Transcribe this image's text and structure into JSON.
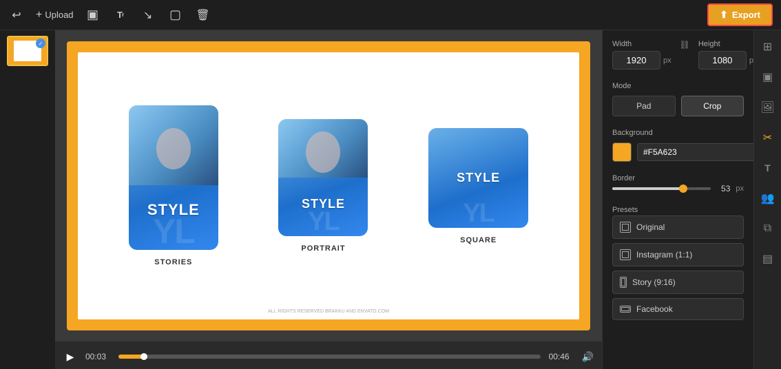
{
  "toolbar": {
    "upload_label": "Upload",
    "export_label": "Export"
  },
  "canvas": {
    "copyright": "ALL RIGHTS RESERVED BRAKKU AND ENVATO.COM",
    "cards": [
      {
        "style_text": "STYLE",
        "bg_text": "YL",
        "label": "STORIES"
      },
      {
        "style_text": "STYLE",
        "bg_text": "YL",
        "label": "PORTRAIT"
      },
      {
        "style_text": "STYLE",
        "bg_text": "YL",
        "label": "SQUARE"
      }
    ]
  },
  "playback": {
    "current_time": "00:03",
    "end_time": "00:46"
  },
  "right_panel": {
    "width_label": "Width",
    "height_label": "Height",
    "width_value": "1920",
    "height_value": "1080",
    "px_unit": "px",
    "mode_label": "Mode",
    "mode_pad": "Pad",
    "mode_crop": "Crop",
    "bg_label": "Background",
    "bg_color": "#F5A623",
    "bg_hex": "#F5A623",
    "border_label": "Border",
    "border_value": "53",
    "presets_label": "Presets",
    "preset_original": "Original",
    "preset_instagram": "Instagram (1:1)",
    "preset_story": "Story (9:16)",
    "preset_facebook": "Facebook"
  },
  "icons": {
    "undo": "↩",
    "plus": "+",
    "save": "⊟",
    "text": "Tᵣ",
    "arrow": "↘",
    "rect": "☐",
    "trash": "🗑",
    "export_icon": "⬆",
    "play": "▶",
    "volume": "🔊",
    "grid": "⊞",
    "frame": "⊡",
    "image": "🖼",
    "crop_active": "✂",
    "text_t": "T",
    "people": "👥",
    "sliders": "⧉",
    "layers": "⊟"
  }
}
